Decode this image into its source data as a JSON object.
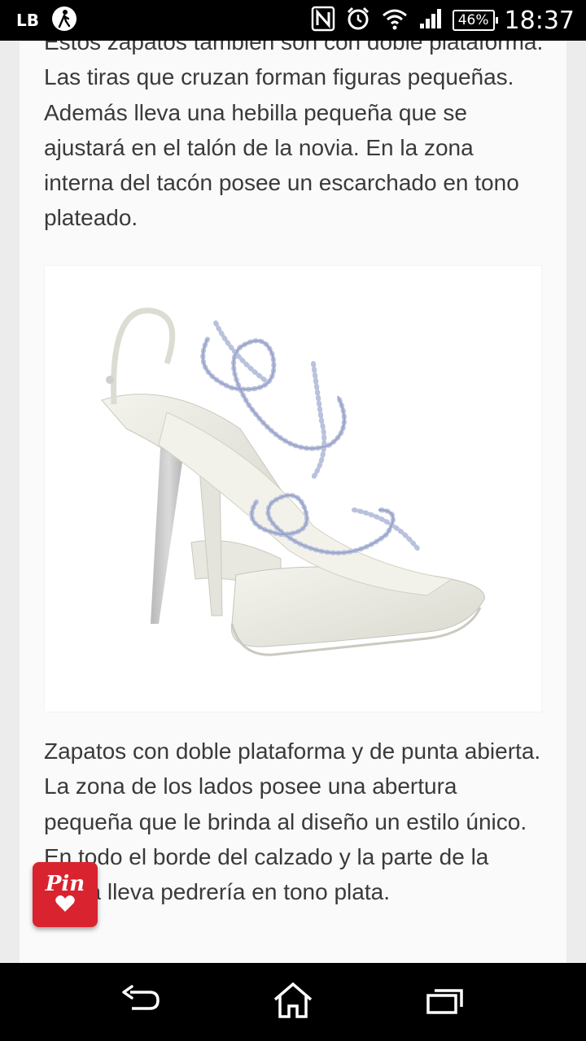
{
  "status_bar": {
    "carrier_badge": "LB",
    "battery": "46%",
    "time": "18:37"
  },
  "article": {
    "paragraph_1": "Estos zapatos también son con doble plataforma. Las tiras que cruzan forman figuras pequeñas. Además lleva una hebilla pequeña que se ajustará en el talón de la novia. En la zona interna del tacón posee un escarchado en tono plateado.",
    "paragraph_2": "Zapatos con doble plataforma y de punta abierta. La zona de los lados posee una abertura pequeña que le brinda al diseño un estilo único. En todo el borde del calzado y la parte de la punta lleva pedrería en tono plata."
  },
  "pin_button": {
    "label": "Pin"
  },
  "nav_bar": {
    "icons": [
      "back-icon",
      "home-icon",
      "recent-apps-icon"
    ]
  },
  "colors": {
    "pin_red": "#d9242f",
    "body_text": "#3a3a3a",
    "card_bg": "#fafafa"
  }
}
